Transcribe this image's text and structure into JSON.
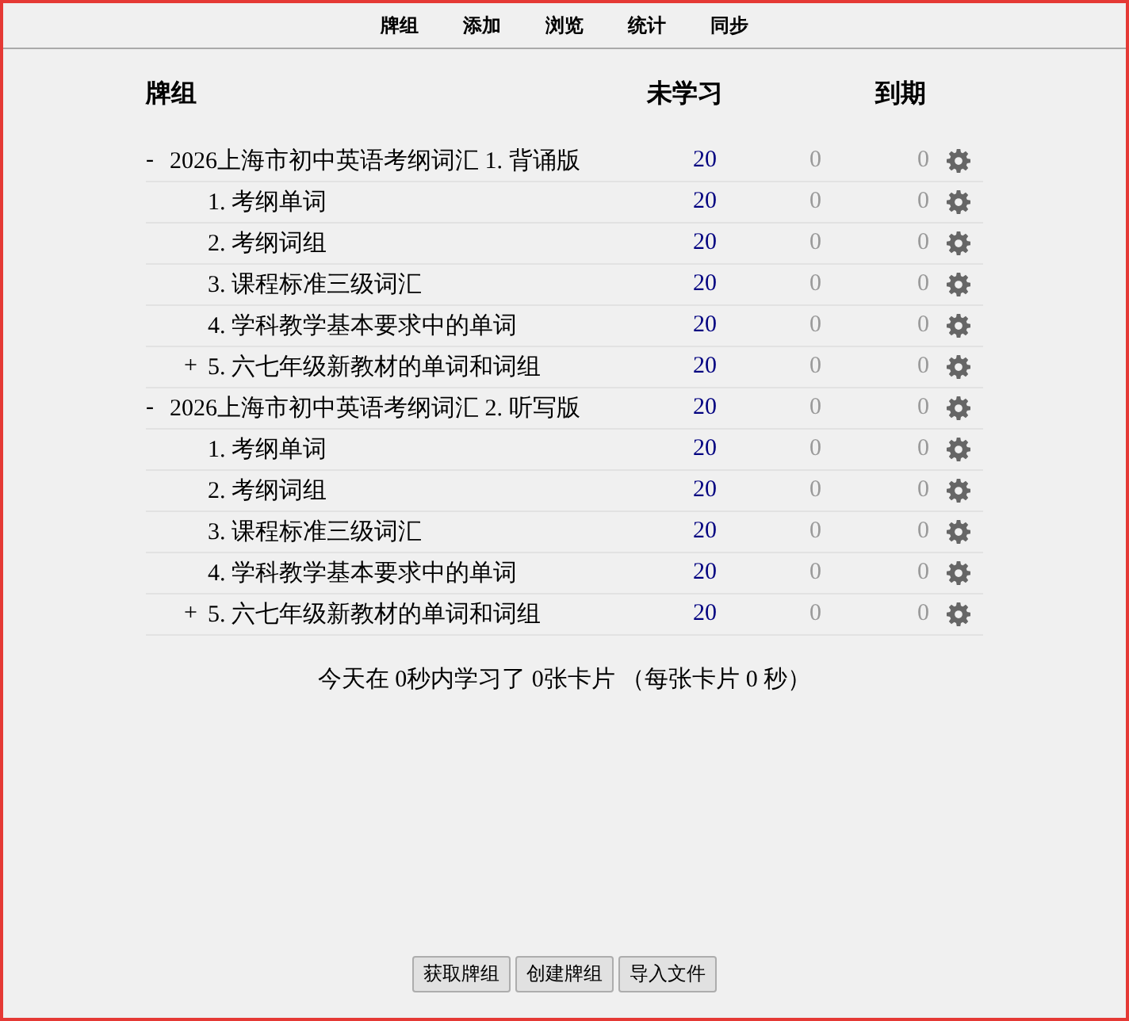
{
  "toolbar": [
    "牌组",
    "添加",
    "浏览",
    "统计",
    "同步"
  ],
  "table": {
    "columns": [
      "牌组",
      "未学习",
      "到期"
    ],
    "decks": [
      {
        "toggle": "-",
        "name": "2026上海市初中英语考纲词汇 1. 背诵版",
        "new": "20",
        "learn": "0",
        "due": "0",
        "children": [
          {
            "name": "1. 考纲单词",
            "new": "20",
            "learn": "0",
            "due": "0"
          },
          {
            "name": "2. 考纲词组",
            "new": "20",
            "learn": "0",
            "due": "0"
          },
          {
            "name": "3. 课程标准三级词汇",
            "new": "20",
            "learn": "0",
            "due": "0"
          },
          {
            "name": "4. 学科教学基本要求中的单词",
            "new": "20",
            "learn": "0",
            "due": "0"
          },
          {
            "toggle": "+",
            "name": "5. 六七年级新教材的单词和词组",
            "new": "20",
            "learn": "0",
            "due": "0"
          }
        ]
      },
      {
        "toggle": "-",
        "name": "2026上海市初中英语考纲词汇 2. 听写版",
        "new": "20",
        "learn": "0",
        "due": "0",
        "children": [
          {
            "name": "1. 考纲单词",
            "new": "20",
            "learn": "0",
            "due": "0"
          },
          {
            "name": "2. 考纲词组",
            "new": "20",
            "learn": "0",
            "due": "0"
          },
          {
            "name": "3. 课程标准三级词汇",
            "new": "20",
            "learn": "0",
            "due": "0"
          },
          {
            "name": "4. 学科教学基本要求中的单词",
            "new": "20",
            "learn": "0",
            "due": "0"
          },
          {
            "toggle": "+",
            "name": "5. 六七年级新教材的单词和词组",
            "new": "20",
            "learn": "0",
            "due": "0"
          }
        ]
      }
    ]
  },
  "stats": "今天在 0秒内学习了 0张卡片 （每张卡片 0 秒）",
  "buttons": [
    "获取牌组",
    "创建牌组",
    "导入文件"
  ]
}
